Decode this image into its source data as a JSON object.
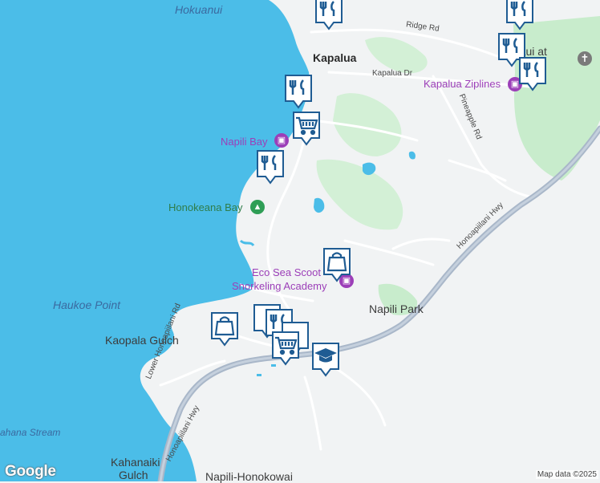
{
  "map": {
    "colors": {
      "water": "#4bbde8",
      "land": "#f1f3f4",
      "park": "#c8eccc",
      "golf": "#d3f0d6",
      "highway": "#a9b7c9",
      "road": "#ffffff",
      "marker": "#1f5c93"
    }
  },
  "labels": {
    "hokuanui": "Hokuanui",
    "kapalua": "Kapalua",
    "ridge_rd": "Ridge Rd",
    "kapalua_dr": "Kapalua Dr",
    "kapalua_ziplines": "Kapalua Ziplines",
    "pineapple_rd": "Pineapple Rd",
    "maui_at": "Maui at",
    "napili_bay": "Napili Bay",
    "honokeana_bay": "Honokeana Bay",
    "honoapiilani_hwy_ne": "Honoapiilani Hwy",
    "eco_sea_1": "Eco Sea Scoot",
    "eco_sea_2": "Snorkeling Academy",
    "napili_park": "Napili Park",
    "haukoe_point": "Haukoe Point",
    "kaopala_gulch": "Kaopala Gulch",
    "lower_honoapiilani_rd": "Lower Honoapiilani Rd",
    "honoapiilani_hwy_sw": "Honoapiilani Hwy",
    "stream": "ahana Stream",
    "kahanaiki_1": "Kahanaiki",
    "kahanaiki_2": "Gulch",
    "napili_honokowai": "Napili-Honokowai",
    "google": "Google",
    "attribution": "Map data ©2025"
  },
  "markers": [
    {
      "name": "restaurant-marker-top",
      "icon": "restaurant"
    },
    {
      "name": "restaurant-marker-top-right",
      "icon": "restaurant"
    },
    {
      "name": "restaurant-marker-ziplines-a",
      "icon": "restaurant"
    },
    {
      "name": "restaurant-marker-ziplines-b",
      "icon": "restaurant"
    },
    {
      "name": "restaurant-marker-kapalua",
      "icon": "restaurant"
    },
    {
      "name": "shopping-cart-marker-napili",
      "icon": "shopping-cart"
    },
    {
      "name": "restaurant-marker-napili",
      "icon": "restaurant"
    },
    {
      "name": "shopping-bag-marker-eco",
      "icon": "shopping-bag"
    },
    {
      "name": "shopping-bag-marker-kaopala",
      "icon": "shopping-bag"
    },
    {
      "name": "restaurant-marker-cluster",
      "icon": "restaurant"
    },
    {
      "name": "shopping-cart-marker-cluster",
      "icon": "shopping-cart"
    },
    {
      "name": "school-marker",
      "icon": "school"
    }
  ]
}
